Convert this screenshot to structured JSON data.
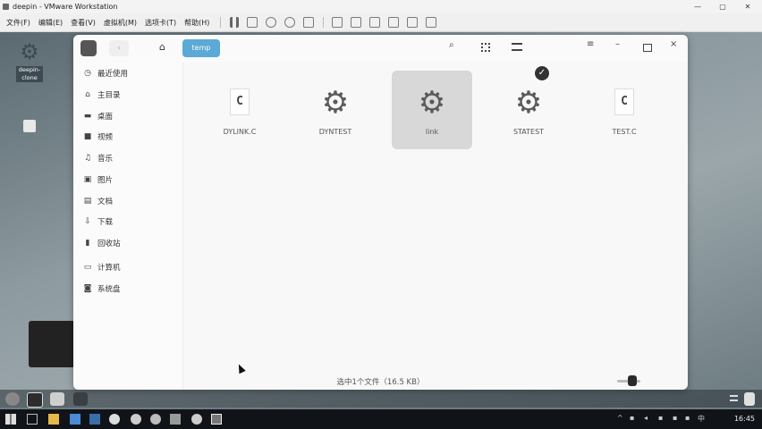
{
  "vmware": {
    "title": "deepin - VMware Workstation",
    "menu": [
      "文件(F)",
      "编辑(E)",
      "查看(V)",
      "虚拟机(M)",
      "选项卡(T)",
      "帮助(H)"
    ],
    "controls": {
      "min": "—",
      "max": "▢",
      "close": "✕"
    }
  },
  "desktop": {
    "icons": [
      {
        "label": "deepin-\nclone"
      }
    ]
  },
  "file_manager": {
    "breadcrumb": {
      "home_icon": "home-icon",
      "current": "temp"
    },
    "sidebar": [
      {
        "label": "最近使用",
        "icon": "clock-icon"
      },
      {
        "label": "主目录",
        "icon": "home-icon"
      },
      {
        "label": "桌面",
        "icon": "desktop-icon"
      },
      {
        "label": "视频",
        "icon": "video-icon"
      },
      {
        "label": "音乐",
        "icon": "music-icon"
      },
      {
        "label": "图片",
        "icon": "picture-icon"
      },
      {
        "label": "文档",
        "icon": "document-icon"
      },
      {
        "label": "下载",
        "icon": "download-icon"
      },
      {
        "label": "回收站",
        "icon": "trash-icon"
      },
      {
        "label": "计算机",
        "icon": "computer-icon"
      },
      {
        "label": "系统盘",
        "icon": "disk-icon"
      }
    ],
    "files": [
      {
        "name": "DYLINK.C",
        "type": "c-source"
      },
      {
        "name": "DYNTEST",
        "type": "executable"
      },
      {
        "name": "link",
        "type": "executable",
        "selected": true
      },
      {
        "name": "STATEST",
        "type": "executable"
      },
      {
        "name": "TEST.C",
        "type": "c-source"
      }
    ],
    "status": "选中1个文件（16.5 KB）"
  },
  "taskbar": {
    "time": "16:45",
    "ime": "中"
  }
}
